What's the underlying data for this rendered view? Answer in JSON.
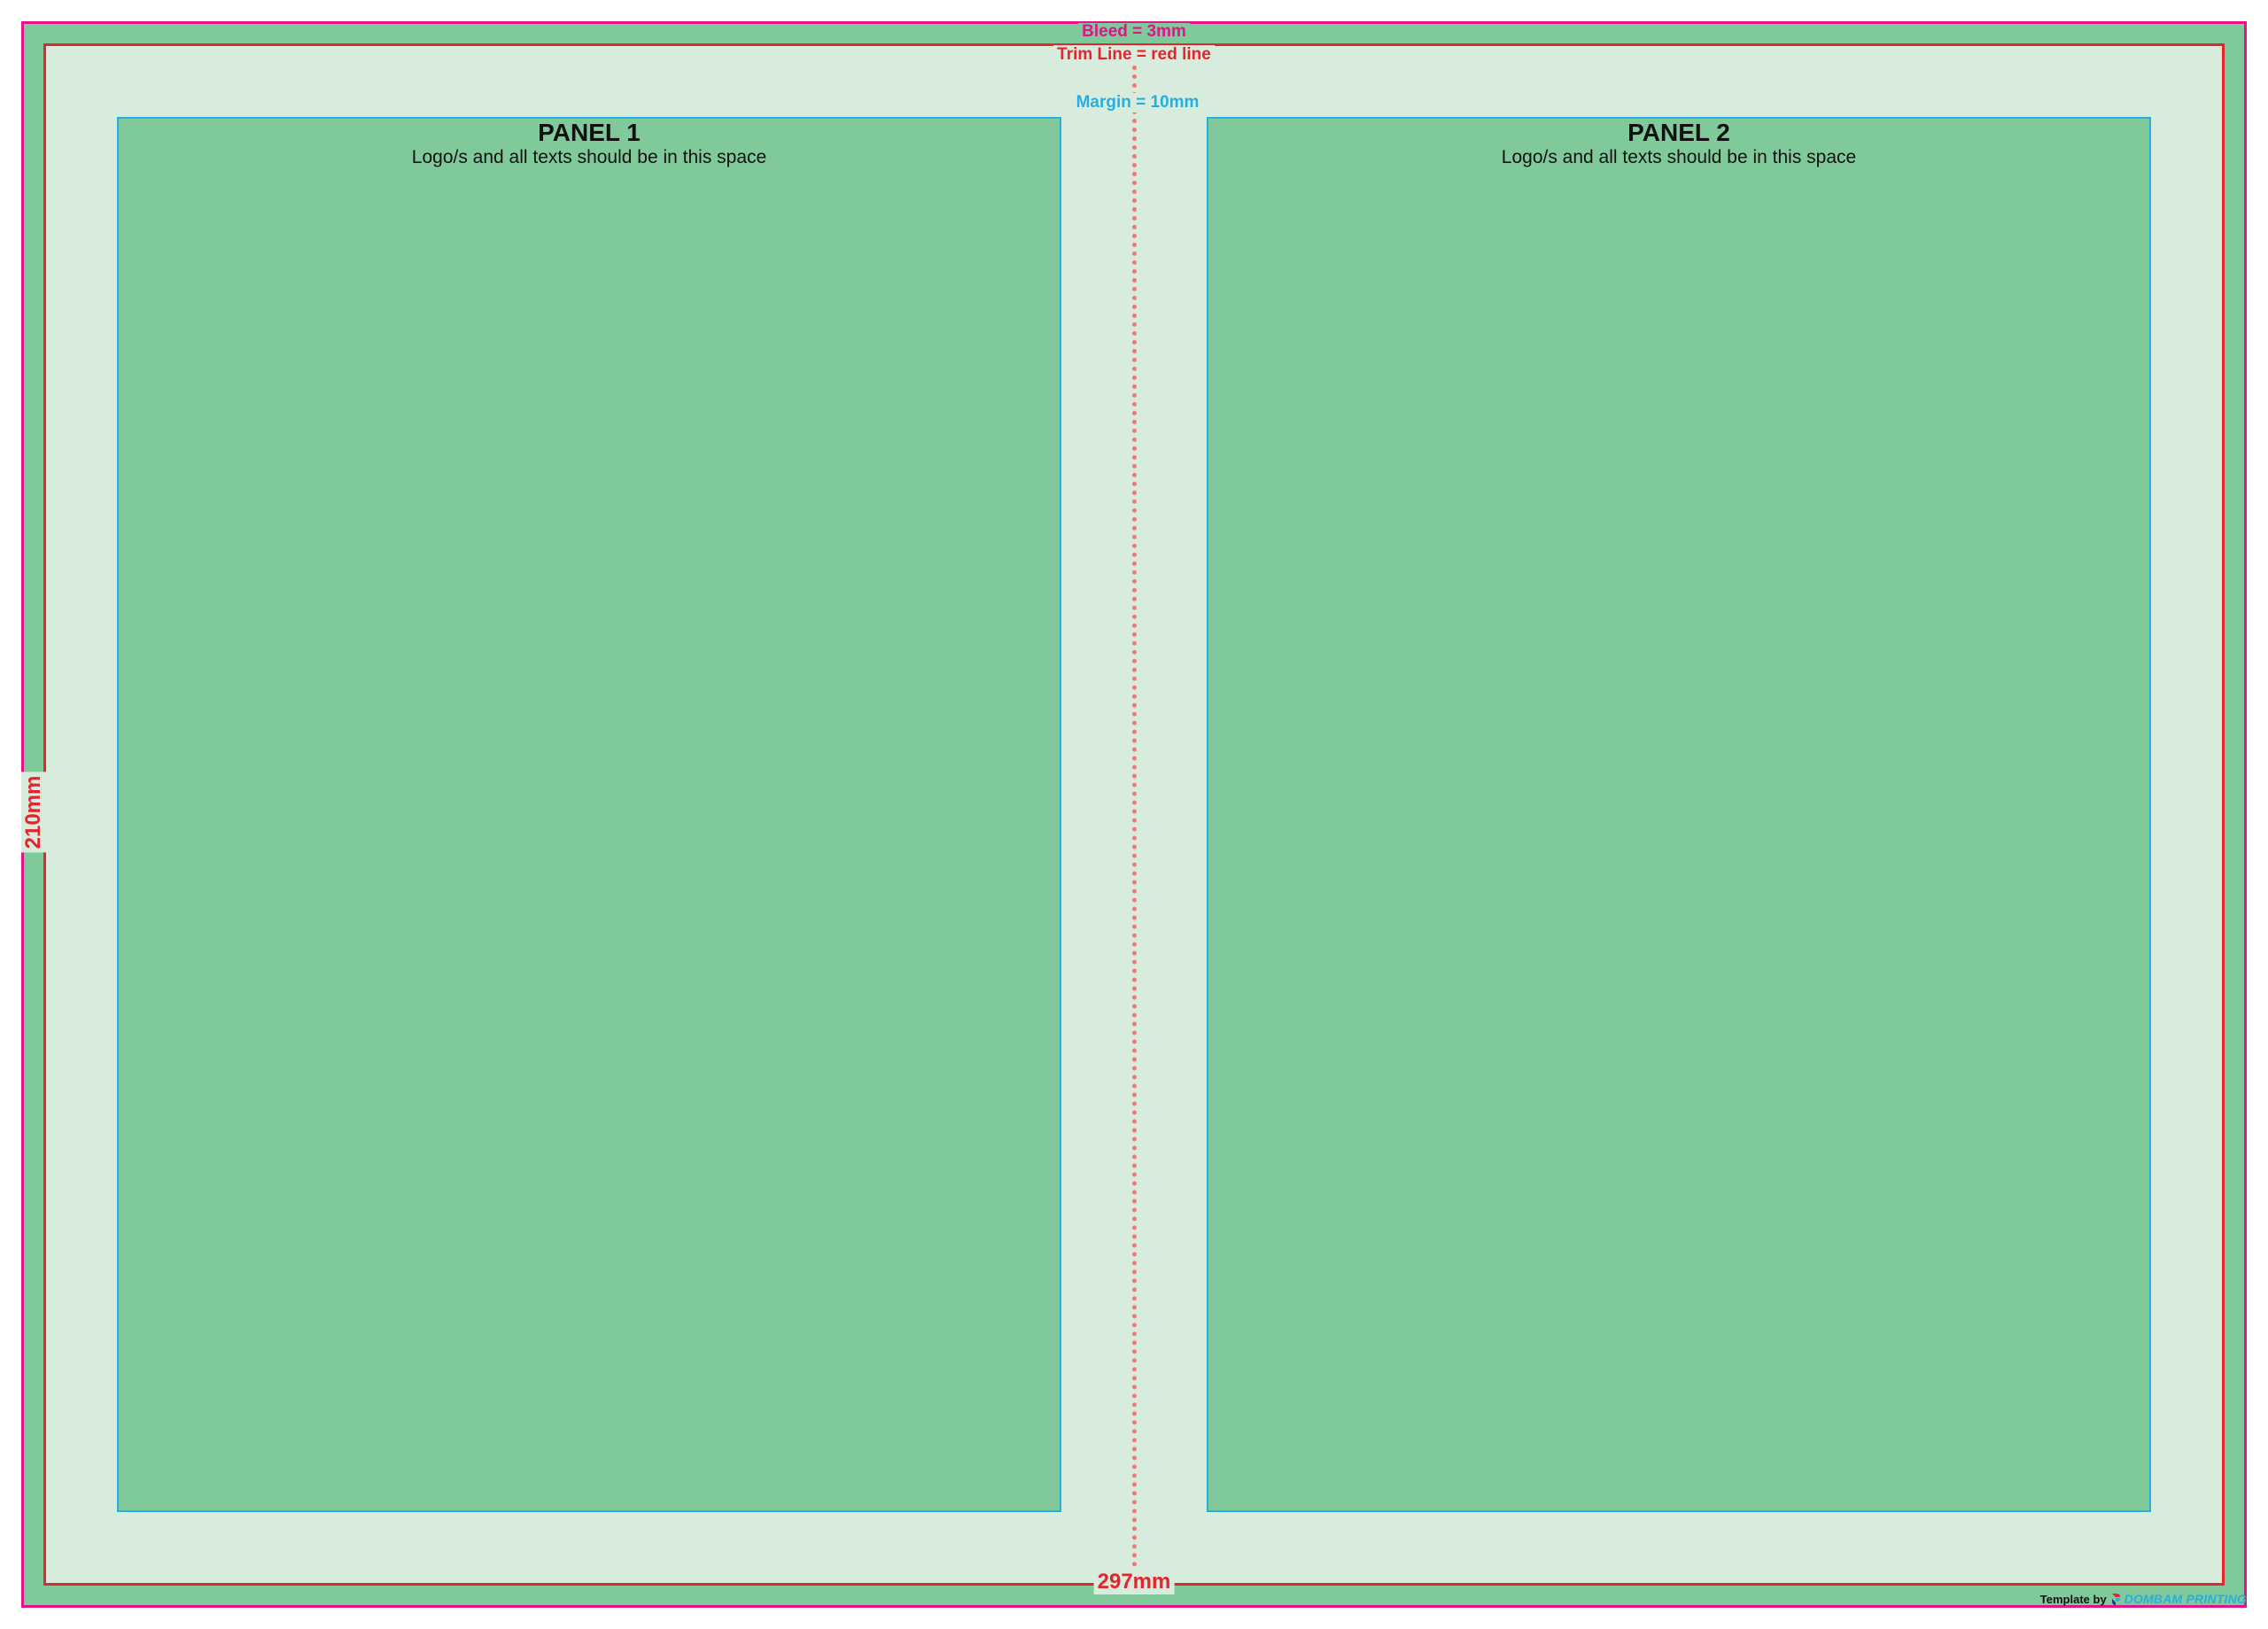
{
  "labels": {
    "bleed": "Bleed = 3mm",
    "trim": "Trim Line = red line",
    "margin": "Margin = 10mm",
    "width": "297mm",
    "height": "210mm"
  },
  "panels": [
    {
      "title": "PANEL 1",
      "subtitle": "Logo/s and all texts should be in this space"
    },
    {
      "title": "PANEL 2",
      "subtitle": "Logo/s and all texts should be in this space"
    }
  ],
  "credit": {
    "prefix": "Template by",
    "brand": "DOMBAM PRINTING",
    "logo_icon": "dombam-logo-icon"
  },
  "colors": {
    "bleed_line": "#e4118c",
    "bleed_fill": "#80c99b",
    "trim_line": "#e3262e",
    "trim_fill": "#d8ecdd",
    "margin_line": "#27aee0",
    "panel_fill": "#80c99b",
    "fold_line": "#ee7a73"
  }
}
